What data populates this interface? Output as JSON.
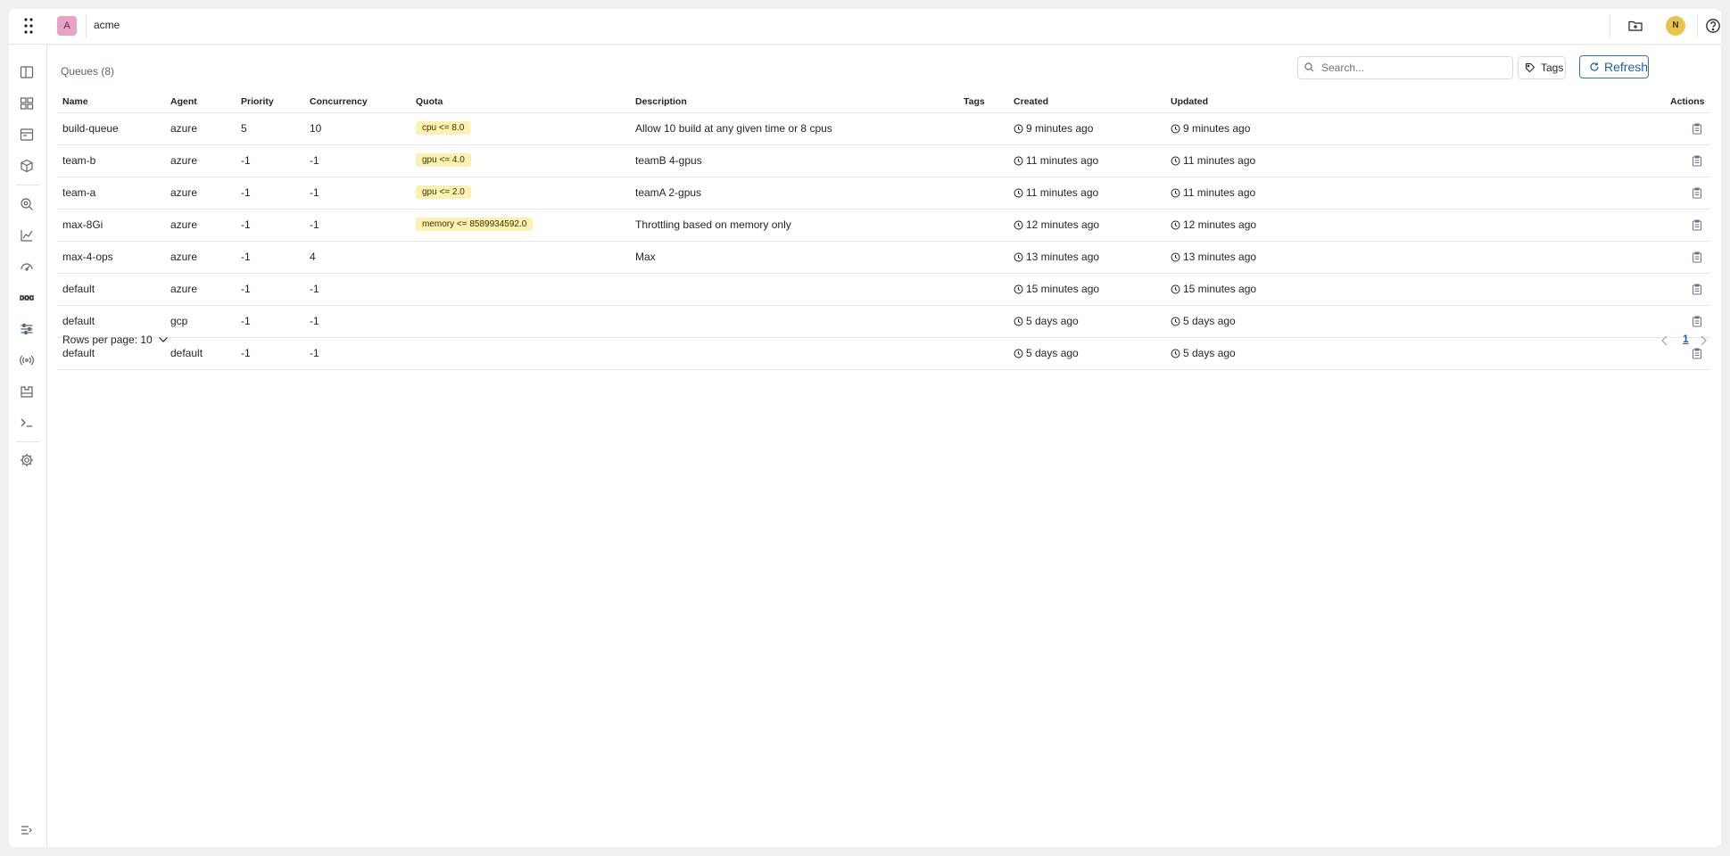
{
  "topbar": {
    "workspace_initial": "A",
    "workspace_name": "acme",
    "user_initial": "N"
  },
  "sidebar": {
    "items": [
      "panel-icon",
      "dashboard-icon",
      "inbox-icon",
      "package-icon",
      "search-icon",
      "chart-icon",
      "gauge-icon",
      "queues-icon",
      "sliders-icon",
      "broadcast-icon",
      "building-icon",
      "terminal-icon",
      "settings-icon",
      "collapse-icon"
    ]
  },
  "main": {
    "title": "Queues (8)",
    "search_placeholder": "Search...",
    "tags_label": "Tags",
    "refresh_label": "Refresh",
    "columns": {
      "name": "Name",
      "agent": "Agent",
      "priority": "Priority",
      "concurrency": "Concurrency",
      "quota": "Quota",
      "description": "Description",
      "tags": "Tags",
      "created": "Created",
      "updated": "Updated",
      "actions": "Actions"
    },
    "rows": [
      {
        "name": "build-queue",
        "agent": "azure",
        "priority": "5",
        "concurrency": "10",
        "quota": "cpu <= 8.0",
        "description": "Allow 10 build at any given time or 8 cpus",
        "created": "9 minutes ago",
        "updated": "9 minutes ago"
      },
      {
        "name": "team-b",
        "agent": "azure",
        "priority": "-1",
        "concurrency": "-1",
        "quota": "gpu <= 4.0",
        "description": "teamB 4-gpus",
        "created": "11 minutes ago",
        "updated": "11 minutes ago"
      },
      {
        "name": "team-a",
        "agent": "azure",
        "priority": "-1",
        "concurrency": "-1",
        "quota": "gpu <= 2.0",
        "description": "teamA 2-gpus",
        "created": "11 minutes ago",
        "updated": "11 minutes ago"
      },
      {
        "name": "max-8Gi",
        "agent": "azure",
        "priority": "-1",
        "concurrency": "-1",
        "quota": "memory <= 8589934592.0",
        "description": "Throttling based on memory only",
        "created": "12 minutes ago",
        "updated": "12 minutes ago"
      },
      {
        "name": "max-4-ops",
        "agent": "azure",
        "priority": "-1",
        "concurrency": "4",
        "quota": "",
        "description": "Max",
        "created": "13 minutes ago",
        "updated": "13 minutes ago"
      },
      {
        "name": "default",
        "agent": "azure",
        "priority": "-1",
        "concurrency": "-1",
        "quota": "",
        "description": "",
        "created": "15 minutes ago",
        "updated": "15 minutes ago"
      },
      {
        "name": "default",
        "agent": "gcp",
        "priority": "-1",
        "concurrency": "-1",
        "quota": "",
        "description": "",
        "created": "5 days ago",
        "updated": "5 days ago"
      },
      {
        "name": "default",
        "agent": "default",
        "priority": "-1",
        "concurrency": "-1",
        "quota": "",
        "description": "",
        "created": "5 days ago",
        "updated": "5 days ago"
      }
    ],
    "pagination": {
      "rows_per_page_label": "Rows per page: 10",
      "current_page": "1"
    }
  },
  "colors": {
    "accent": "#1f5fa8",
    "quota_badge": "#fbf1b0",
    "workspace_avatar": "#e7a3c4",
    "user_avatar": "#e9c64a"
  }
}
